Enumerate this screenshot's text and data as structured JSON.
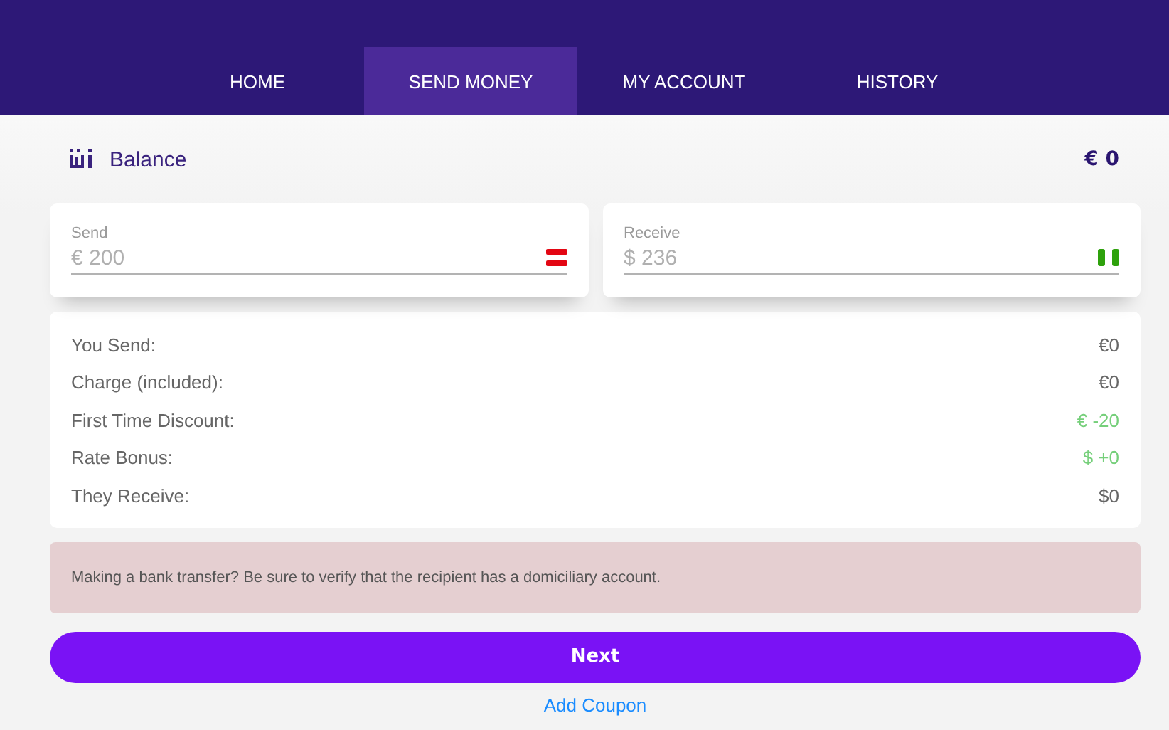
{
  "nav": {
    "tabs": [
      {
        "label": "HOME",
        "selected": false
      },
      {
        "label": "SEND MONEY",
        "selected": true
      },
      {
        "label": "MY ACCOUNT",
        "selected": false
      },
      {
        "label": "HISTORY",
        "selected": false
      }
    ]
  },
  "balance": {
    "label": "Balance",
    "amount": "€ 0"
  },
  "fields": [
    {
      "label": "Send",
      "placeholder": "€ 200"
    },
    {
      "label": "Receive",
      "placeholder": "$ 236"
    }
  ],
  "summary": [
    {
      "label": "You Send:",
      "value": "€0",
      "highlight": false
    },
    {
      "label": "Charge (included):",
      "value": "€0",
      "highlight": false
    },
    {
      "label": "First Time Discount:",
      "value": "€ -20",
      "highlight": true
    },
    {
      "label": "Rate Bonus:",
      "value": "$ +0",
      "highlight": true
    },
    {
      "label": "They Receive:",
      "value": "$0",
      "highlight": false
    }
  ],
  "notice": "Making a bank transfer? Be sure to verify that the recipient has a domiciliary account.",
  "next_button": "Next",
  "coupon_link": "Add Coupon"
}
